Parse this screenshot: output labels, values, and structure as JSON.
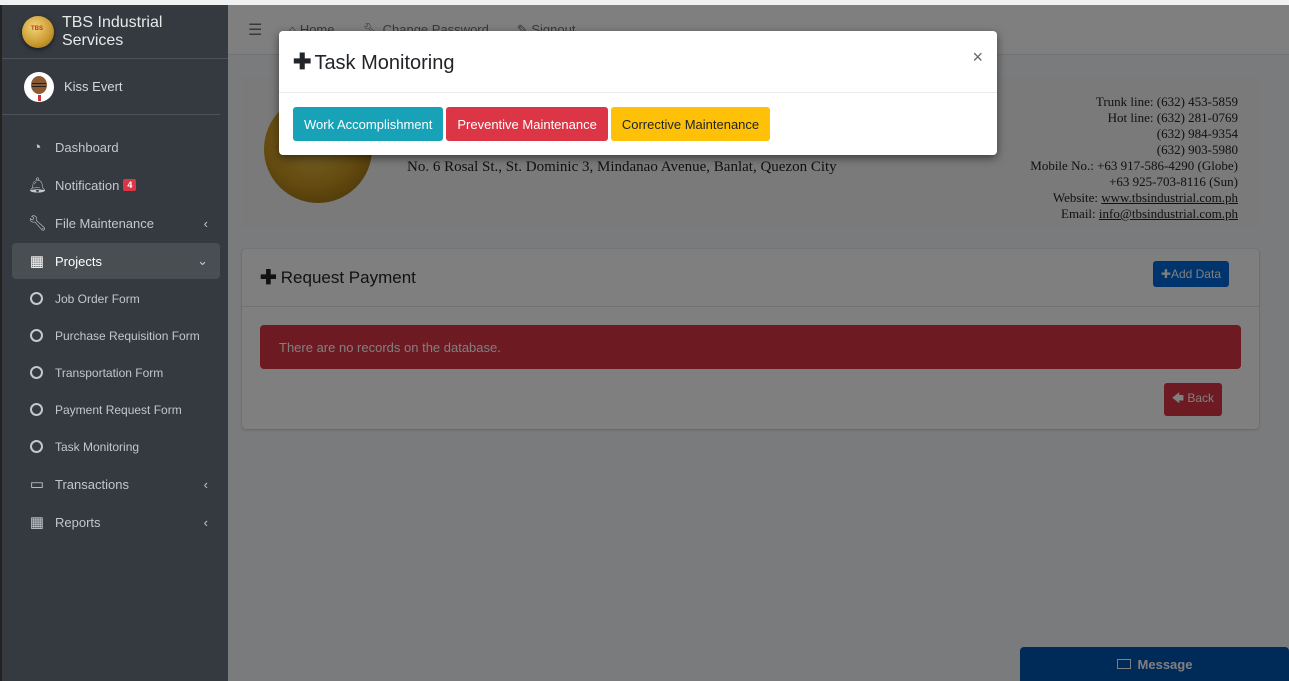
{
  "app": {
    "brand": "TBS Industrial Services",
    "brand_logo_text": "TBS",
    "user_name": "Kiss Evert"
  },
  "sidebar": {
    "items": [
      {
        "label": "Dashboard",
        "icon": "tachometer-icon"
      },
      {
        "label": "Notification",
        "icon": "bell-icon",
        "badge": "4"
      },
      {
        "label": "File Maintenance",
        "icon": "wrench-icon",
        "arrow": "‹"
      },
      {
        "label": "Projects",
        "icon": "grid-icon",
        "arrow": "⌄",
        "active": true
      },
      {
        "label": "Transactions",
        "icon": "calendar-icon",
        "arrow": "‹"
      },
      {
        "label": "Reports",
        "icon": "calendar-grid-icon",
        "arrow": "‹"
      }
    ],
    "sub_items": [
      {
        "label": "Job Order Form"
      },
      {
        "label": "Purchase Requisition Form"
      },
      {
        "label": "Transportation Form"
      },
      {
        "label": "Payment Request Form"
      },
      {
        "label": "Task Monitoring"
      }
    ]
  },
  "navbar": {
    "menu_icon": "☰",
    "links": [
      {
        "label": "Home",
        "icon": "home-icon"
      },
      {
        "label": "Change Password",
        "icon": "wrench-icon"
      },
      {
        "label": "Signout",
        "icon": "edit-icon"
      }
    ]
  },
  "letterhead": {
    "address": "No. 6 Rosal St., St. Dominic 3, Mindanao Avenue, Banlat, Quezon City",
    "contact_lines": [
      "Trunk line: (632) 453-5859",
      "Hot line: (632) 281-0769",
      "(632) 984-9354",
      "(632) 903-5980",
      "Mobile No.: +63 917-586-4290 (Globe)",
      "+63 925-703-8116 (Sun)"
    ],
    "website_label": "Website:",
    "website": "www.tbsindustrial.com.ph",
    "email_label": "Email:",
    "email": "info@tbsindustrial.com.ph"
  },
  "card": {
    "title": "Request Payment",
    "add_button": "Add Data",
    "alert": "There are no records on the database.",
    "back_button": "Back"
  },
  "message_button": "Message",
  "modal": {
    "title": "Task Monitoring",
    "close": "×",
    "buttons": [
      {
        "label": "Work Accomplishment",
        "color": "#17a2b8"
      },
      {
        "label": "Preventive Maintenance",
        "color": "#dc3545"
      },
      {
        "label": "Corrective Maintenance",
        "color": "#ffc107"
      }
    ]
  }
}
